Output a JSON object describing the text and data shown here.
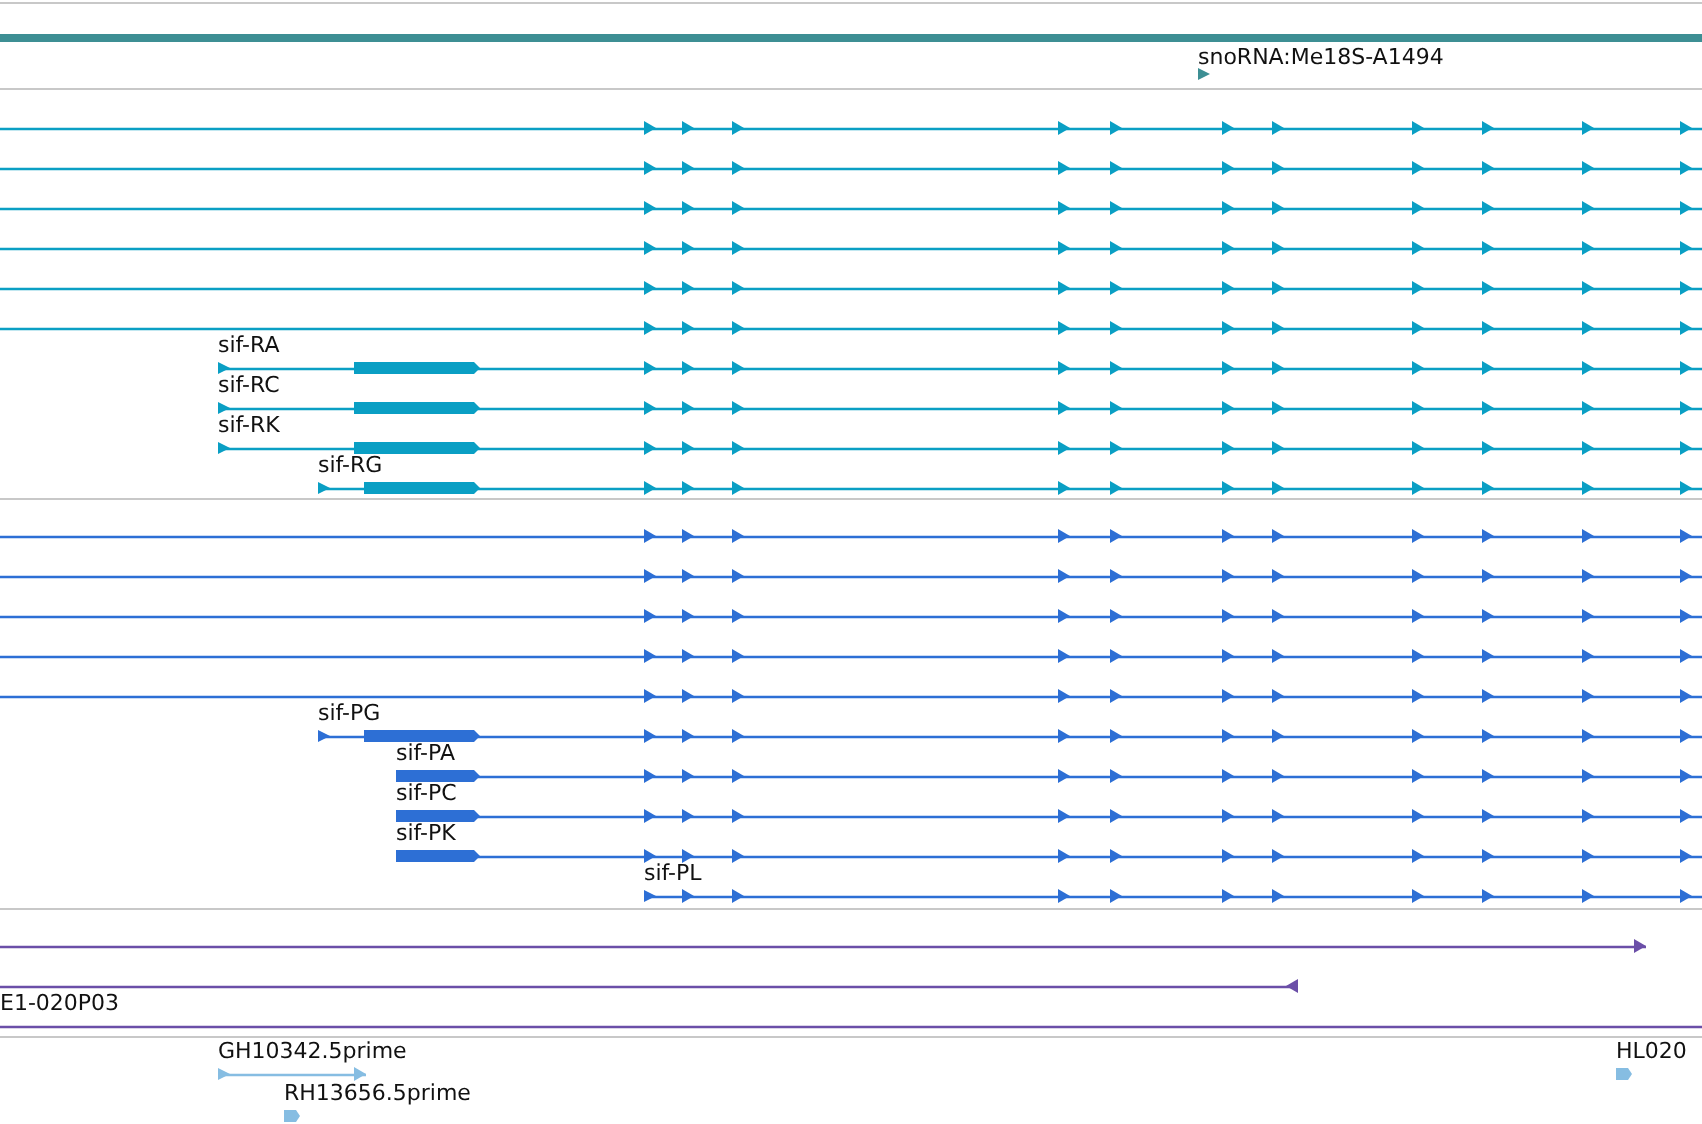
{
  "tracks": [
    {
      "kind": "gene",
      "color": "#3d8f94",
      "features": [
        {
          "kind": "bar"
        },
        {
          "kind": "snorna",
          "label": "snoRNA:Me18S-A1494"
        }
      ]
    },
    {
      "kind": "transcripts",
      "color": "#0a9fc4",
      "features": [
        {
          "kind": "transcript"
        },
        {
          "kind": "transcript"
        },
        {
          "kind": "transcript"
        },
        {
          "kind": "transcript"
        },
        {
          "kind": "transcript"
        },
        {
          "kind": "transcript"
        },
        {
          "kind": "transcript",
          "label": "sif-RA"
        },
        {
          "kind": "transcript",
          "label": "sif-RC"
        },
        {
          "kind": "transcript",
          "label": "sif-RK"
        },
        {
          "kind": "transcript",
          "label": "sif-RG"
        }
      ]
    },
    {
      "kind": "proteins",
      "color": "#2d6fd5",
      "features": [
        {
          "kind": "transcript"
        },
        {
          "kind": "transcript"
        },
        {
          "kind": "transcript"
        },
        {
          "kind": "transcript"
        },
        {
          "kind": "transcript"
        },
        {
          "kind": "transcript",
          "label": "sif-PG"
        },
        {
          "kind": "transcript",
          "label": "sif-PA"
        },
        {
          "kind": "transcript",
          "label": "sif-PC"
        },
        {
          "kind": "transcript",
          "label": "sif-PK"
        },
        {
          "kind": "transcript",
          "label": "sif-PL"
        }
      ]
    },
    {
      "kind": "clones",
      "color": "#6b4fa8",
      "features": [
        {
          "kind": "span"
        },
        {
          "kind": "span"
        },
        {
          "kind": "span",
          "label": "E1-020P03"
        }
      ]
    },
    {
      "kind": "ests",
      "color": "#86bde2",
      "features": [
        {
          "kind": "span",
          "label": "GH10342.5prime"
        },
        {
          "kind": "span",
          "label": "RH13656.5prime"
        },
        {
          "kind": "span",
          "label": "HL020"
        }
      ]
    }
  ]
}
